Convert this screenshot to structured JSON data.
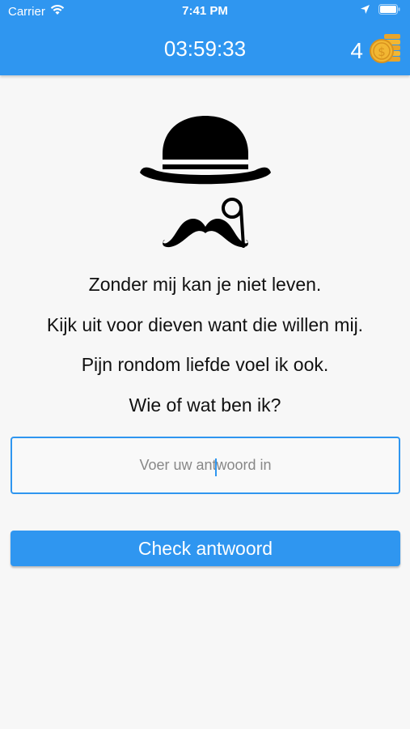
{
  "status_bar": {
    "carrier": "Carrier",
    "time": "7:41 PM"
  },
  "header": {
    "timer": "03:59:33",
    "coin_count": "4"
  },
  "riddle": {
    "lines": [
      "Zonder mij kan je niet leven.",
      "Kijk uit voor dieven want die willen mij.",
      "Pijn rondom liefde voel ik ook.",
      "Wie of wat ben ik?"
    ]
  },
  "answer": {
    "placeholder": "Voer uw antwoord in",
    "value": ""
  },
  "actions": {
    "check_label": "Check antwoord"
  },
  "colors": {
    "accent": "#2f96f0",
    "coin": "#f2b733",
    "background": "#f7f7f7"
  },
  "icons": [
    "wifi-icon",
    "location-arrow-icon",
    "battery-icon",
    "coins-icon",
    "gentleman-mascot-icon"
  ]
}
